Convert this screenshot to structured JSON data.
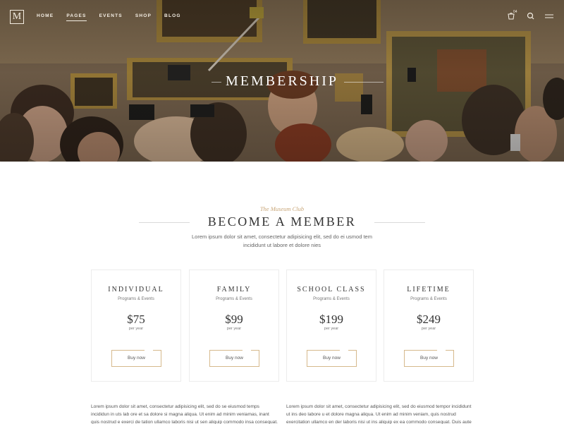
{
  "nav": {
    "logo": "M",
    "items": [
      "HOME",
      "PAGES",
      "EVENTS",
      "SHOP",
      "BLOG"
    ],
    "active_index": 1,
    "cart_count": "04",
    "icons": [
      "cart-icon",
      "search-icon",
      "menu-icon"
    ]
  },
  "hero": {
    "title": "MEMBERSHIP"
  },
  "section": {
    "kicker": "The Museum Club",
    "title": "BECOME A MEMBER",
    "subtitle": "Lorem ipsum dolor sit amet, consectetur adipisicing elit, sed do ei usmod tem incididunt ut labore et dolore nies"
  },
  "plans": [
    {
      "title": "INDIVIDUAL",
      "sub": "Programs & Events",
      "price": "$75",
      "period": "per year",
      "button": "Buy now"
    },
    {
      "title": "FAMILY",
      "sub": "Programs & Events",
      "price": "$99",
      "period": "per year",
      "button": "Buy now"
    },
    {
      "title": "SCHOOL CLASS",
      "sub": "Programs & Events",
      "price": "$199",
      "period": "per year",
      "button": "Buy now"
    },
    {
      "title": "LIFETIME",
      "sub": "Programs & Events",
      "price": "$249",
      "period": "per year",
      "button": "Buy now"
    }
  ],
  "footer_text": {
    "left": "Lorem ipsum dolor sit amet, consectetur adipisicing elit, sed do se eiusmod temps incididun in uts lab ore et sa dolore si magna aliqua. Ut enim ad minim veniamas, inant quis nostrud e exerci de tation ullamco laboris nisi ut sen aliquip commodo insa consequat. Duis aute irure do se dolor",
    "right": "Lorem ipsum dolor sit amet, consectetur adipisicing elit, sed do eiusmod tempor incididunt ut ins deo labore u et dolore magna aliqua. Ut enim ad minim veniam, quis nostrud exercitation ullamco en der laboris nisi ut ins aliquip ex ea commodo consequat. Duis aute irure dolor in"
  },
  "colors": {
    "accent": "#c8a678",
    "button_border": "#d6b98c",
    "heading": "#333333"
  }
}
